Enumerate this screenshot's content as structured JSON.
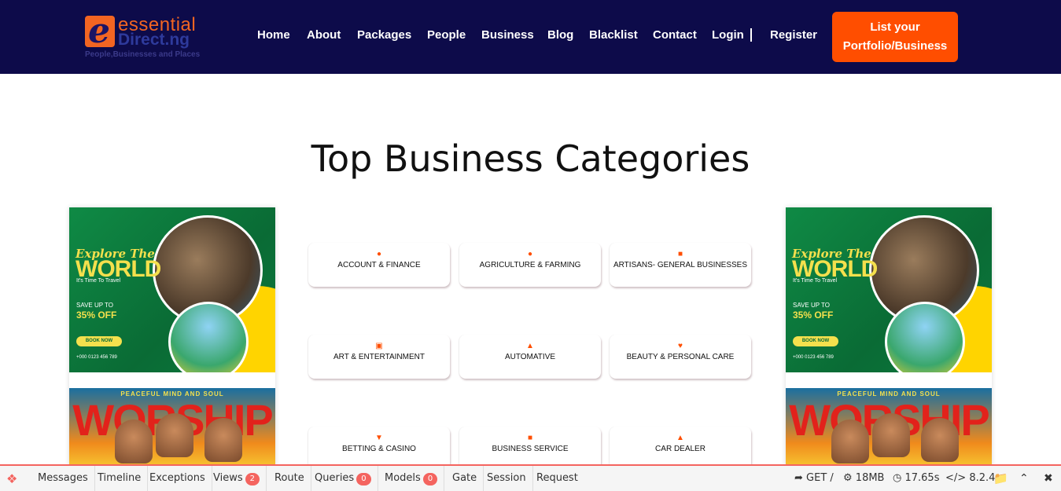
{
  "header": {
    "logo": {
      "line1": "essential",
      "line2": "Direct.ng",
      "tagline": "People,Businesses and Places",
      "letter": "e"
    },
    "nav": [
      "Home",
      "About",
      "Packages",
      "People",
      "Business",
      "Blog",
      "Blacklist",
      "Contact",
      "Login",
      "Register"
    ],
    "cta": {
      "line1": "List your",
      "line2": "Portfolio/Business"
    }
  },
  "main": {
    "title": "Top Business Categories",
    "categories": [
      {
        "label": "ACCOUNT & FINANCE",
        "icon": "piggy-bank-icon"
      },
      {
        "label": "AGRICULTURE & FARMING",
        "icon": "tractor-icon"
      },
      {
        "label": "ARTISANS- GENERAL BUSINESSES",
        "icon": "toolbox-icon"
      },
      {
        "label": "ART & ENTERTAINMENT",
        "icon": "film-icon"
      },
      {
        "label": "AUTOMATIVE",
        "icon": "car-icon"
      },
      {
        "label": "BEAUTY & PERSONAL CARE",
        "icon": "heart-icon"
      },
      {
        "label": "BETTING & CASINO",
        "icon": "trophy-icon"
      },
      {
        "label": "BUSINESS SERVICE",
        "icon": "briefcase-icon"
      },
      {
        "label": "CAR DEALER",
        "icon": "car-icon"
      }
    ]
  },
  "ads": {
    "travel": {
      "explore": "Explore The",
      "world": "WORLD",
      "sub": "It's Time To Travel",
      "save": "SAVE UP TO",
      "off": "35% OFF",
      "book": "BOOK NOW",
      "contact": "+000 0123 456 789"
    },
    "worship": {
      "top": "PEACEFUL MIND AND SOUL",
      "big": "WORSHIP"
    }
  },
  "debugbar": {
    "items": [
      "Messages",
      "Timeline",
      "Exceptions",
      "Views",
      "Route",
      "Queries",
      "Models",
      "Gate",
      "Session",
      "Request"
    ],
    "views_count": "2",
    "queries_count": "0",
    "models_count": "0",
    "method": "GET /",
    "memory": "18MB",
    "time": "17.65s",
    "php": "8.2.4"
  },
  "colors": {
    "header_bg": "#0d0b4a",
    "accent": "#ff4e00",
    "debug_accent": "#f4645f"
  }
}
